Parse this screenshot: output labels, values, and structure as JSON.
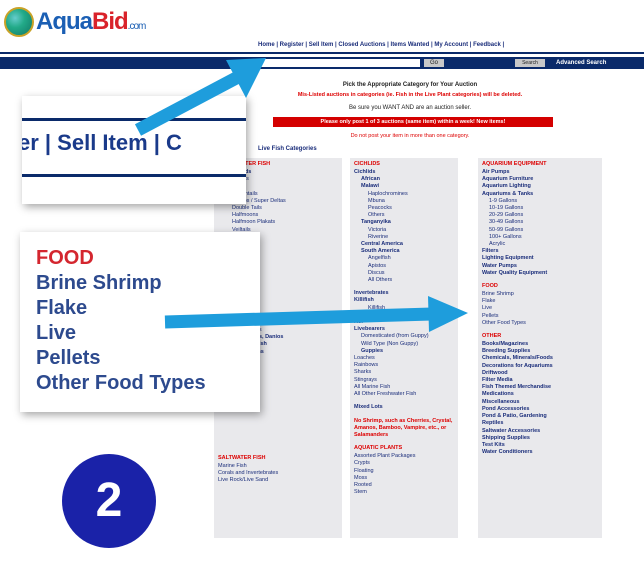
{
  "logo": {
    "aqua": "Aqua",
    "bid": "Bid",
    "com": ".com"
  },
  "topnav": {
    "links": "Home | Register | Sell Item | Closed Auctions | Items Wanted | My Account | Feedback |"
  },
  "search": {
    "go_label": "Go",
    "select_label": "Search",
    "advanced_label": "Advanced Search"
  },
  "header": {
    "pick_title": "Pick the Appropriate Category for Your Auction",
    "red_note": "Mis-Listed auctions in categories (ie. Fish in the Live Plant categories) will be deleted.",
    "wanted_note": "Be sure you WANT AND are an auction seller.",
    "banner": "Please only post 1 of 3 auctions (same item) within a week! New items!",
    "red_note2": "Do not post your item in more than one category.",
    "live_cats": "Live Fish Categories"
  },
  "columns": {
    "left": {
      "heading": "FRESHWATER FISH",
      "items": [
        {
          "t": "Anabantoids",
          "c": "b"
        },
        {
          "t": "Gouramis",
          "c": "i1"
        },
        {
          "t": "Bettas",
          "c": "i1 b"
        },
        {
          "t": "Crowntails",
          "c": "i2"
        },
        {
          "t": "Combs / Super Deltas",
          "c": "i2"
        },
        {
          "t": "Double Tails",
          "c": "i2"
        },
        {
          "t": "Halfmoons",
          "c": "i2"
        },
        {
          "t": "Halfmoon Plakats",
          "c": "i2"
        },
        {
          "t": "Veiltails",
          "c": "i2"
        }
      ],
      "mid_items": [
        {
          "t": "Loaches, Sharks, Corydoras",
          "c": "b"
        },
        {
          "t": "Catfish, Plecos",
          "c": "i1"
        },
        {
          "t": "Cyprinids, Barbs, Danios",
          "c": "b"
        },
        {
          "t": "Rainbows, Killifish",
          "c": "b"
        },
        {
          "t": "Tetras, Characins",
          "c": "b"
        },
        {
          "t": "Goldfish, Koi",
          "c": "b"
        }
      ],
      "bottom_heading": "SALTWATER FISH",
      "bottom_items": [
        {
          "t": "Marine Fish",
          "c": ""
        },
        {
          "t": "Corals and Invertebrates",
          "c": ""
        },
        {
          "t": "Live Rock/Live Sand",
          "c": ""
        }
      ]
    },
    "middle": {
      "heading": "CICHLIDS",
      "items": [
        {
          "t": "Cichlids",
          "c": "b"
        },
        {
          "t": "African",
          "c": "i1 b"
        },
        {
          "t": "Malawi",
          "c": "i1 b"
        },
        {
          "t": "Haplochromines",
          "c": "i2"
        },
        {
          "t": "Mbuna",
          "c": "i2"
        },
        {
          "t": "Peacocks",
          "c": "i2"
        },
        {
          "t": "Others",
          "c": "i2"
        },
        {
          "t": "Tanganyika",
          "c": "i1 b"
        },
        {
          "t": "Victoria",
          "c": "i2"
        },
        {
          "t": "Riverine",
          "c": "i2"
        },
        {
          "t": "Central America",
          "c": "i1 b"
        },
        {
          "t": "South America",
          "c": "i1 b"
        },
        {
          "t": "Angelfish",
          "c": "i2"
        },
        {
          "t": "Apistos",
          "c": "i2"
        },
        {
          "t": "Discus",
          "c": "i2"
        },
        {
          "t": "All Others",
          "c": "i2"
        }
      ],
      "mid_items": [
        {
          "t": "Invertebrates",
          "c": "b"
        },
        {
          "t": "Killifish",
          "c": "b"
        },
        {
          "t": "Killifish",
          "c": "i2"
        },
        {
          "t": "Killie Eggs",
          "c": "i2"
        },
        {
          "t": "Koi",
          "c": "b"
        },
        {
          "t": "Livebearers",
          "c": "b"
        },
        {
          "t": "Domesticated (from Guppy)",
          "c": "i1"
        },
        {
          "t": "Wild Type (Non Guppy)",
          "c": "i1"
        },
        {
          "t": "Guppies",
          "c": "i1 b"
        },
        {
          "t": "Loaches",
          "c": ""
        },
        {
          "t": "Rainbows",
          "c": ""
        },
        {
          "t": "Sharks",
          "c": ""
        },
        {
          "t": "Stingrays",
          "c": ""
        },
        {
          "t": "All Marine Fish",
          "c": ""
        },
        {
          "t": "All Other Freshwater Fish",
          "c": ""
        }
      ],
      "mixed_lots": "Mixed Lots",
      "red_note": "No Shrimp, such as Cherries, Crystal, Amanos, Bamboo, Vampire, etc., or Salamanders",
      "bottom_heading": "AQUATIC PLANTS",
      "bottom_items": [
        {
          "t": "Assorted Plant Packages",
          "c": ""
        },
        {
          "t": "Crypts",
          "c": ""
        },
        {
          "t": "Floating",
          "c": ""
        },
        {
          "t": "Moss",
          "c": ""
        },
        {
          "t": "Rooted",
          "c": ""
        },
        {
          "t": "Stem",
          "c": ""
        }
      ]
    },
    "right": {
      "heading": "AQUARIUM EQUIPMENT",
      "items": [
        {
          "t": "Air Pumps",
          "c": "b"
        },
        {
          "t": "Aquarium Furniture",
          "c": "b"
        },
        {
          "t": "Aquarium Lighting",
          "c": "b"
        },
        {
          "t": "Aquariums & Tanks",
          "c": "b"
        },
        {
          "t": "1-9 Gallons",
          "c": "i1"
        },
        {
          "t": "10-19 Gallons",
          "c": "i1"
        },
        {
          "t": "20-29 Gallons",
          "c": "i1"
        },
        {
          "t": "30-49 Gallons",
          "c": "i1"
        },
        {
          "t": "50-99 Gallons",
          "c": "i1"
        },
        {
          "t": "100+ Gallons",
          "c": "i1"
        },
        {
          "t": "Acrylic",
          "c": "i1"
        },
        {
          "t": "Filters",
          "c": "b"
        },
        {
          "t": "Lighting Equipment",
          "c": "b"
        },
        {
          "t": "Water Pumps",
          "c": "b"
        },
        {
          "t": "Water Quality Equipment",
          "c": "b"
        }
      ],
      "food_heading": "FOOD",
      "food_items": [
        {
          "t": "Brine Shrimp",
          "c": ""
        },
        {
          "t": "Flake",
          "c": ""
        },
        {
          "t": "Live",
          "c": ""
        },
        {
          "t": "Pellets",
          "c": ""
        },
        {
          "t": "Other Food Types",
          "c": ""
        }
      ],
      "other_heading": "OTHER",
      "other_items": [
        {
          "t": "Books/Magazines",
          "c": "b"
        },
        {
          "t": "Breeding Supplies",
          "c": "b"
        },
        {
          "t": "Chemicals, Minerals/Foods",
          "c": "b"
        },
        {
          "t": "Decorations for Aquariums",
          "c": "b"
        },
        {
          "t": "Driftwood",
          "c": "b"
        },
        {
          "t": "Filter Media",
          "c": "b"
        },
        {
          "t": "Fish Themed Merchandise",
          "c": "b"
        },
        {
          "t": "Medications",
          "c": "b"
        },
        {
          "t": "Miscellaneous",
          "c": "b"
        },
        {
          "t": "Pond Accessories",
          "c": "b"
        },
        {
          "t": "Pond & Patio, Gardening",
          "c": "b"
        },
        {
          "t": "Reptiles",
          "c": "b"
        },
        {
          "t": "Saltwater Accessories",
          "c": "b"
        },
        {
          "t": "Shipping Supplies",
          "c": "b"
        },
        {
          "t": "Test Kits",
          "c": "b"
        },
        {
          "t": "Water Conditioners",
          "c": "b"
        }
      ]
    }
  },
  "zoom1": {
    "text": "er | Sell Item | C"
  },
  "zoom2": {
    "heading": "FOOD",
    "items": [
      "Brine Shrimp",
      "Flake",
      "Live",
      "Pellets",
      "Other Food Types"
    ]
  },
  "badge": {
    "step": "2"
  },
  "colors": {
    "navy": "#0a2a6a",
    "red": "#d4262f",
    "arrow": "#1e9ddc",
    "badge": "#1a22a8"
  },
  "icons": {
    "arrow1": "arrow-up-right-icon",
    "arrow2": "arrow-right-icon"
  }
}
